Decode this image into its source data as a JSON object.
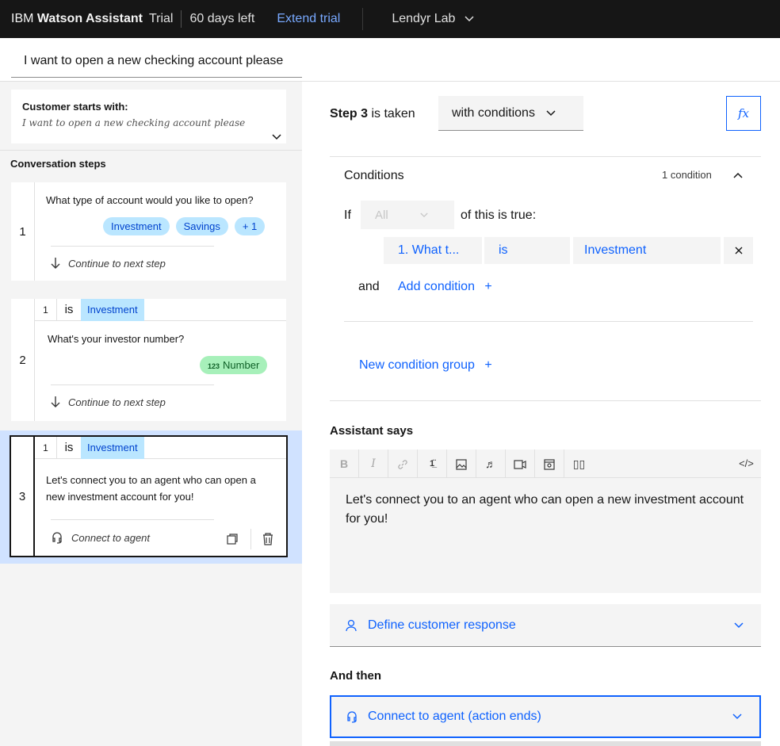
{
  "topbar": {
    "brand_prefix": "IBM",
    "brand_name": "Watson Assistant",
    "plan": "Trial",
    "days_left": "60 days left",
    "extend_label": "Extend trial",
    "workspace": "Lendyr Lab"
  },
  "action_name": "I want to open a new checking account please",
  "customer_starts": {
    "title": "Customer starts with:",
    "text": "I want to open a new checking account please"
  },
  "conversation_steps": {
    "title": "Conversation steps",
    "steps": [
      {
        "number": "1",
        "question": "What type of account would you like to open?",
        "chips": [
          "Investment",
          "Savings",
          "+ 1"
        ],
        "next": "Continue to next step"
      },
      {
        "number": "2",
        "condition": {
          "ref": "1",
          "op": "is",
          "value": "Investment"
        },
        "question": "What's your investor number?",
        "chip": "Number",
        "chip_icon": "123",
        "next": "Continue to next step"
      },
      {
        "number": "3",
        "condition": {
          "ref": "1",
          "op": "is",
          "value": "Investment"
        },
        "question_line1": "Let's connect you to an agent who can open a",
        "question_line2": "new investment account for you!",
        "next": "Connect to agent"
      }
    ]
  },
  "editor": {
    "step_label_bold": "Step 3",
    "step_label_rest": "is taken",
    "taken_mode": "with conditions",
    "fx_label": "fx",
    "conditions": {
      "title": "Conditions",
      "count": "1 condition",
      "if_label": "If",
      "all_option": "All",
      "of_true": "of this is true:",
      "row": {
        "field": "1. What t...",
        "op": "is",
        "value": "Investment"
      },
      "and_label": "and",
      "add_condition": "Add condition",
      "new_group": "New condition group"
    },
    "assistant_says": {
      "title": "Assistant says",
      "text": "Let's connect you to an agent who can open a new investment account for you!"
    },
    "define_response": "Define customer response",
    "and_then": {
      "title": "And then",
      "value": "Connect to agent (action ends)"
    }
  },
  "colors": {
    "accent": "#0f62fe",
    "topbar": "#161616",
    "chip_blue": "#bae6ff",
    "chip_green": "#a7f0ba",
    "selected_step": "#d0e2ff"
  }
}
